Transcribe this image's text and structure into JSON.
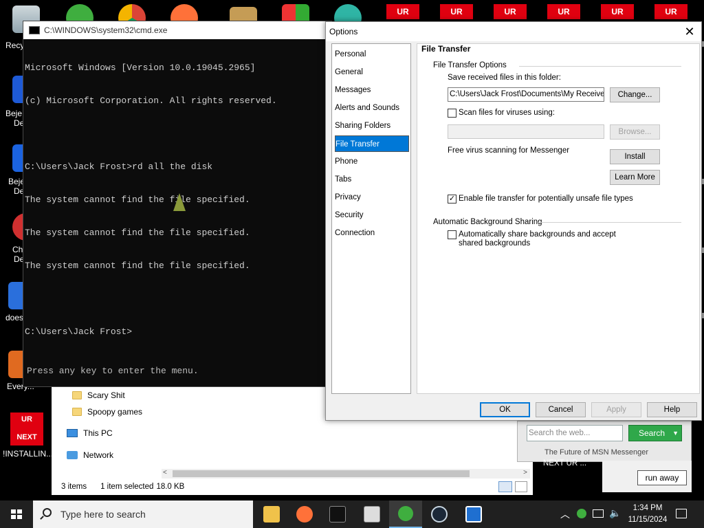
{
  "desktop": {
    "icons": [
      "Recycl",
      "Beje",
      "De",
      "Beje",
      "De",
      "Ch",
      "De",
      "does",
      "Every..."
    ],
    "ur_badges": [
      "UR",
      "UR",
      "UR",
      "UR",
      "UR",
      "UR"
    ],
    "ur_tile": {
      "line1": "UR",
      "line2": "NEXT",
      "label": "!INSTALLIN..."
    },
    "next_ur_label": "NEXT UR ...",
    "run_away_label": "run away"
  },
  "cmd": {
    "title": "C:\\WINDOWS\\system32\\cmd.exe",
    "lines": [
      "Microsoft Windows [Version 10.0.19045.2965]",
      "(c) Microsoft Corporation. All rights reserved.",
      "",
      "C:\\Users\\Jack Frost>rd all the disk",
      "The system cannot find the file specified.",
      "The system cannot find the file specified.",
      "The system cannot find the file specified.",
      "",
      "C:\\Users\\Jack Frost>"
    ],
    "footer": "Press any key to enter the menu."
  },
  "explorer": {
    "items": [
      "Scary Shit",
      "Spoopy games"
    ],
    "nav": [
      "This PC",
      "Network"
    ],
    "status": {
      "items": "3 items",
      "selected": "1 item selected",
      "size": "18.0 KB"
    }
  },
  "options": {
    "title": "Options",
    "categories": [
      "Personal",
      "General",
      "Messages",
      "Alerts and Sounds",
      "Sharing Folders",
      "File Transfer",
      "Phone",
      "Tabs",
      "Privacy",
      "Security",
      "Connection"
    ],
    "selected_category": "File Transfer",
    "panel": {
      "heading": "File Transfer",
      "group1": "File Transfer Options",
      "save_label": "Save received files in this folder:",
      "save_path": "C:\\Users\\Jack Frost\\Documents\\My Received",
      "change_btn": "Change...",
      "scan_label": "Scan files for viruses using:",
      "scan_checked": false,
      "scan_path": "",
      "browse_btn": "Browse...",
      "free_scan_label": "Free virus scanning for Messenger",
      "install_btn": "Install",
      "learn_btn": "Learn More",
      "unsafe_label": "Enable file transfer for potentially unsafe file types",
      "unsafe_checked": true,
      "group2": "Automatic Background Sharing",
      "share_label_1": "Automatically share backgrounds and accept",
      "share_label_2": "shared backgrounds",
      "share_checked": false
    },
    "buttons": {
      "ok": "OK",
      "cancel": "Cancel",
      "apply": "Apply",
      "help": "Help"
    }
  },
  "msn": {
    "search_placeholder": "Search the web...",
    "search_btn": "Search",
    "footer": "The Future of MSN Messenger"
  },
  "taskbar": {
    "search_placeholder": "Type here to search",
    "time": "1:34 PM",
    "date": "11/15/2024"
  }
}
